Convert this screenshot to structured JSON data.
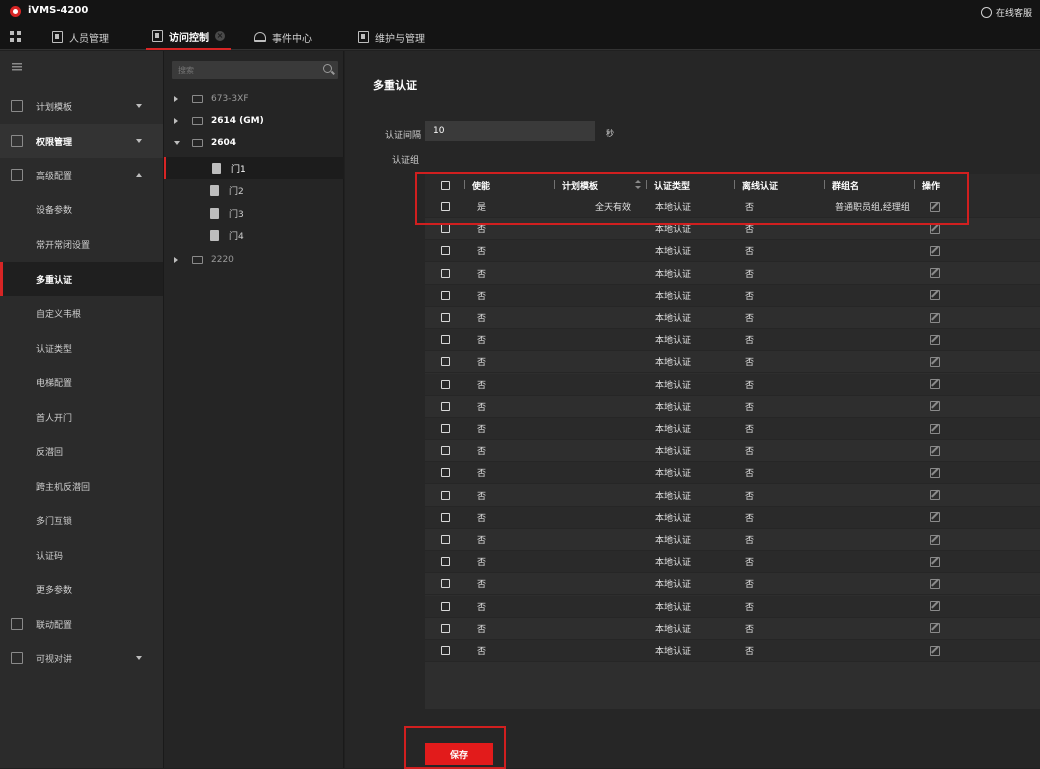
{
  "app": {
    "title": "iVMS-4200",
    "online_service": "在线客服"
  },
  "tabs": [
    {
      "label": "人员管理"
    },
    {
      "label": "访问控制"
    },
    {
      "label": "事件中心"
    },
    {
      "label": "维护与管理"
    }
  ],
  "sidebar": {
    "items": [
      {
        "label": "计划模板"
      },
      {
        "label": "权限管理"
      },
      {
        "label": "高级配置"
      },
      {
        "label": "设备参数"
      },
      {
        "label": "常开常闭设置"
      },
      {
        "label": "多重认证"
      },
      {
        "label": "自定义韦根"
      },
      {
        "label": "认证类型"
      },
      {
        "label": "电梯配置"
      },
      {
        "label": "首人开门"
      },
      {
        "label": "反潜回"
      },
      {
        "label": "跨主机反潜回"
      },
      {
        "label": "多门互锁"
      },
      {
        "label": "认证码"
      },
      {
        "label": "更多参数"
      },
      {
        "label": "联动配置"
      },
      {
        "label": "可视对讲"
      }
    ]
  },
  "tree": {
    "search_placeholder": "搜索",
    "nodes": [
      {
        "label": "673-3XF"
      },
      {
        "label": "2614 (GM)"
      },
      {
        "label": "2604"
      },
      {
        "label": "门1"
      },
      {
        "label": "门2"
      },
      {
        "label": "门3"
      },
      {
        "label": "门4"
      },
      {
        "label": "2220"
      }
    ]
  },
  "main": {
    "title": "多重认证",
    "interval_label": "认证间隔",
    "interval_value": "10",
    "interval_unit": "秒",
    "group_label": "认证组",
    "save_label": "保存"
  },
  "table": {
    "columns": [
      "使能",
      "计划模板",
      "认证类型",
      "离线认证",
      "群组名",
      "操作"
    ],
    "rows": [
      {
        "enabled": "是",
        "template": "全天有效",
        "auth_type": "本地认证",
        "offline": "否",
        "group": "普通职员组,经理组"
      },
      {
        "enabled": "否",
        "template": "",
        "auth_type": "本地认证",
        "offline": "否",
        "group": ""
      },
      {
        "enabled": "否",
        "template": "",
        "auth_type": "本地认证",
        "offline": "否",
        "group": ""
      },
      {
        "enabled": "否",
        "template": "",
        "auth_type": "本地认证",
        "offline": "否",
        "group": ""
      },
      {
        "enabled": "否",
        "template": "",
        "auth_type": "本地认证",
        "offline": "否",
        "group": ""
      },
      {
        "enabled": "否",
        "template": "",
        "auth_type": "本地认证",
        "offline": "否",
        "group": ""
      },
      {
        "enabled": "否",
        "template": "",
        "auth_type": "本地认证",
        "offline": "否",
        "group": ""
      },
      {
        "enabled": "否",
        "template": "",
        "auth_type": "本地认证",
        "offline": "否",
        "group": ""
      },
      {
        "enabled": "否",
        "template": "",
        "auth_type": "本地认证",
        "offline": "否",
        "group": ""
      },
      {
        "enabled": "否",
        "template": "",
        "auth_type": "本地认证",
        "offline": "否",
        "group": ""
      },
      {
        "enabled": "否",
        "template": "",
        "auth_type": "本地认证",
        "offline": "否",
        "group": ""
      },
      {
        "enabled": "否",
        "template": "",
        "auth_type": "本地认证",
        "offline": "否",
        "group": ""
      },
      {
        "enabled": "否",
        "template": "",
        "auth_type": "本地认证",
        "offline": "否",
        "group": ""
      },
      {
        "enabled": "否",
        "template": "",
        "auth_type": "本地认证",
        "offline": "否",
        "group": ""
      },
      {
        "enabled": "否",
        "template": "",
        "auth_type": "本地认证",
        "offline": "否",
        "group": ""
      },
      {
        "enabled": "否",
        "template": "",
        "auth_type": "本地认证",
        "offline": "否",
        "group": ""
      },
      {
        "enabled": "否",
        "template": "",
        "auth_type": "本地认证",
        "offline": "否",
        "group": ""
      },
      {
        "enabled": "否",
        "template": "",
        "auth_type": "本地认证",
        "offline": "否",
        "group": ""
      },
      {
        "enabled": "否",
        "template": "",
        "auth_type": "本地认证",
        "offline": "否",
        "group": ""
      },
      {
        "enabled": "否",
        "template": "",
        "auth_type": "本地认证",
        "offline": "否",
        "group": ""
      },
      {
        "enabled": "否",
        "template": "",
        "auth_type": "本地认证",
        "offline": "否",
        "group": ""
      }
    ]
  },
  "colors": {
    "accent": "#d72525",
    "highlight": "#d11f1f",
    "save_button": "#e21b1b"
  }
}
